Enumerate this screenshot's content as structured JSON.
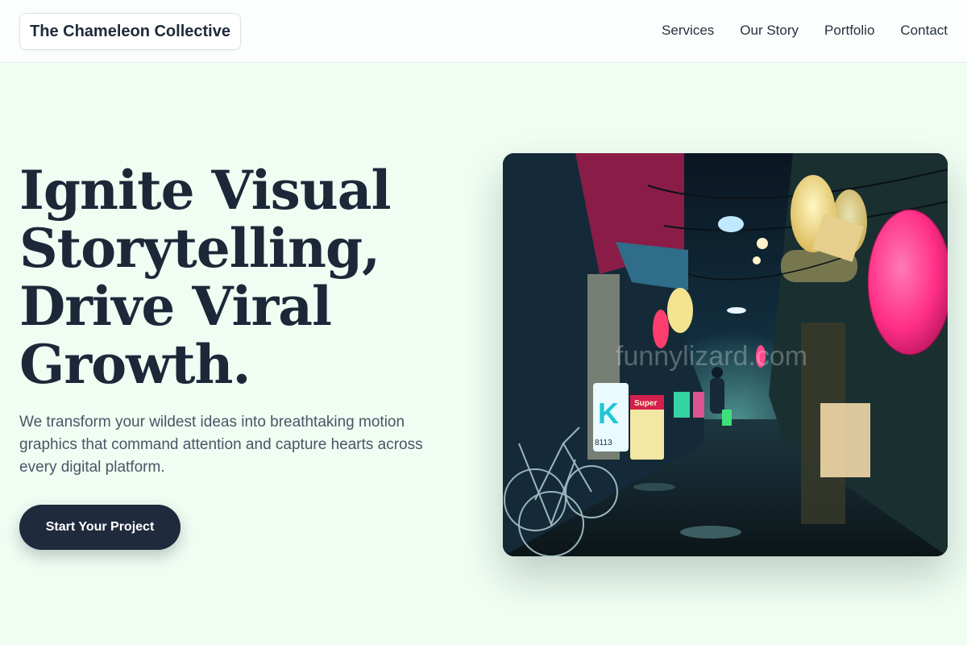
{
  "header": {
    "brand": "The Chameleon Collective",
    "nav": [
      {
        "label": "Services"
      },
      {
        "label": "Our Story"
      },
      {
        "label": "Portfolio"
      },
      {
        "label": "Contact"
      }
    ]
  },
  "hero": {
    "title_lines": [
      "Ignite Visual",
      "Storytelling,",
      "Drive Viral",
      "Growth."
    ],
    "subtitle": "We transform your wildest ideas into breathtaking motion graphics that command attention and capture hearts across every digital platform.",
    "cta_label": "Start Your Project",
    "image": {
      "subject": "neon-lit night alley with paper lanterns and bicycles",
      "sign_texts": [
        "Super",
        "8113"
      ],
      "watermark": "funnylizard.com"
    }
  },
  "colors": {
    "page_bg": "#effdf3",
    "header_bg": "#fbfefc",
    "title": "#1c2838",
    "body_text": "#4b5565",
    "cta_bg": "#1f2a3c",
    "cta_text": "#ffffff",
    "lantern_pink": "#ff3d8f"
  }
}
